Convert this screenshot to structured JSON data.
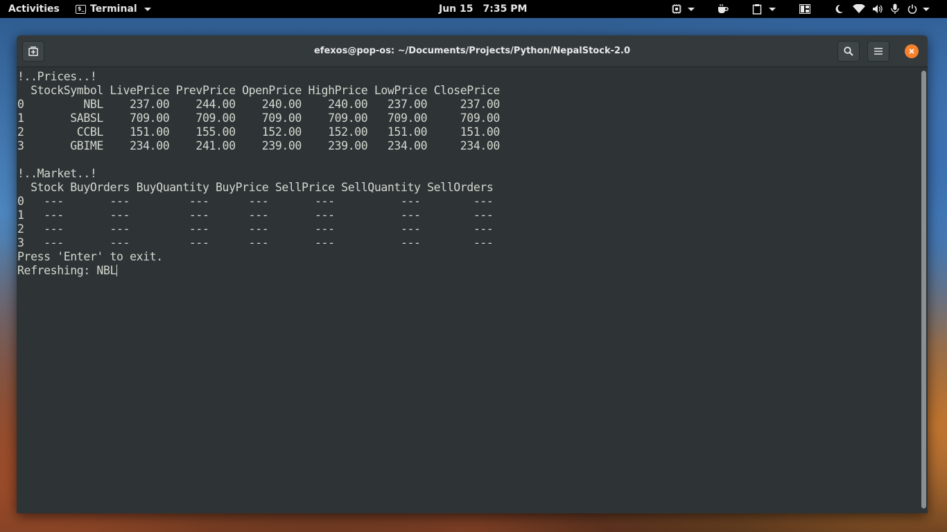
{
  "topbar": {
    "activities": "Activities",
    "app_name": "Terminal",
    "date": "Jun 15",
    "time": "7:35 PM"
  },
  "window": {
    "title": "efexos@pop-os: ~/Documents/Projects/Python/NepalStock-2.0"
  },
  "terminal": {
    "lines": [
      "!..Prices..!",
      "  StockSymbol LivePrice PrevPrice OpenPrice HighPrice LowPrice ClosePrice",
      "0         NBL    237.00    244.00    240.00    240.00   237.00     237.00",
      "1       SABSL    709.00    709.00    709.00    709.00   709.00     709.00",
      "2        CCBL    151.00    155.00    152.00    152.00   151.00     151.00",
      "3       GBIME    234.00    241.00    239.00    239.00   234.00     234.00",
      "",
      "!..Market..!",
      "  Stock BuyOrders BuyQuantity BuyPrice SellPrice SellQuantity SellOrders",
      "0   ---       ---         ---      ---       ---          ---        ---",
      "1   ---       ---         ---      ---       ---          ---        ---",
      "2   ---       ---         ---      ---       ---          ---        ---",
      "3   ---       ---         ---      ---       ---          ---        ---",
      "Press 'Enter' to exit.",
      "Refreshing: NBL"
    ]
  },
  "icons": {
    "new_tab": "new-tab-icon",
    "search": "search-icon",
    "menu": "hamburger-menu-icon",
    "close": "close-icon"
  },
  "colors": {
    "accent_close": "#f6822d",
    "terminal_bg": "#2e3436",
    "terminal_fg": "#d3d7cf"
  }
}
